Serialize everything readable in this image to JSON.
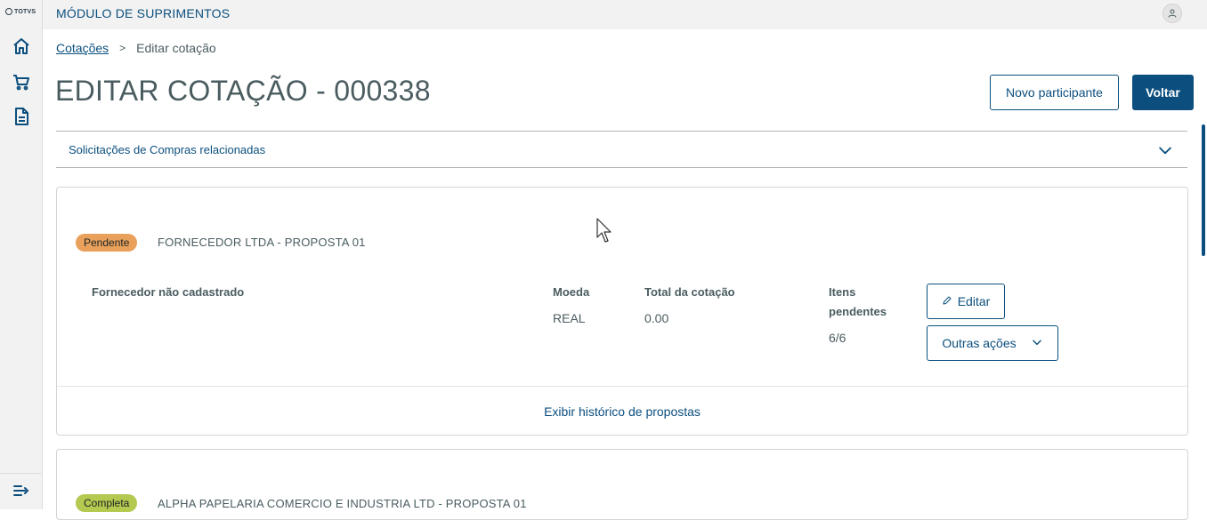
{
  "sidebar": {
    "logo_text": "TOTVS",
    "icons": [
      "home-icon",
      "shopping-cart-icon",
      "document-icon"
    ],
    "collapse_icon": "menu-collapse-icon"
  },
  "header": {
    "module_title": "MÓDULO DE SUPRIMENTOS",
    "user_icon": "user-icon"
  },
  "breadcrumb": {
    "parent": "Cotações",
    "separator": ">",
    "current": "Editar cotação"
  },
  "page": {
    "title": "EDITAR COTAÇÃO - 000338",
    "new_participant_label": "Novo participante",
    "back_label": "Voltar"
  },
  "accordion": {
    "label": "Solicitações de Compras relacionadas"
  },
  "proposals": [
    {
      "status": "Pendente",
      "supplier": "FORNECEDOR LTDA - PROPOSTA 01",
      "supplier_note": "Fornecedor não cadastrado",
      "currency_label": "Moeda",
      "currency_value": "REAL",
      "total_label": "Total da cotação",
      "total_value": "0.00",
      "pending_label_line1": "Itens",
      "pending_label_line2": "pendentes",
      "pending_value": "6/6",
      "edit_label": "Editar",
      "other_actions_label": "Outras ações",
      "history_label": "Exibir histórico de propostas"
    },
    {
      "status": "Completa",
      "supplier": "ALPHA PAPELARIA COMERCIO E INDUSTRIA LTD - PROPOSTA 01"
    }
  ],
  "colors": {
    "primary": "#0c4f7e",
    "pending": "#e8a05a",
    "complete": "#b3c94f"
  }
}
